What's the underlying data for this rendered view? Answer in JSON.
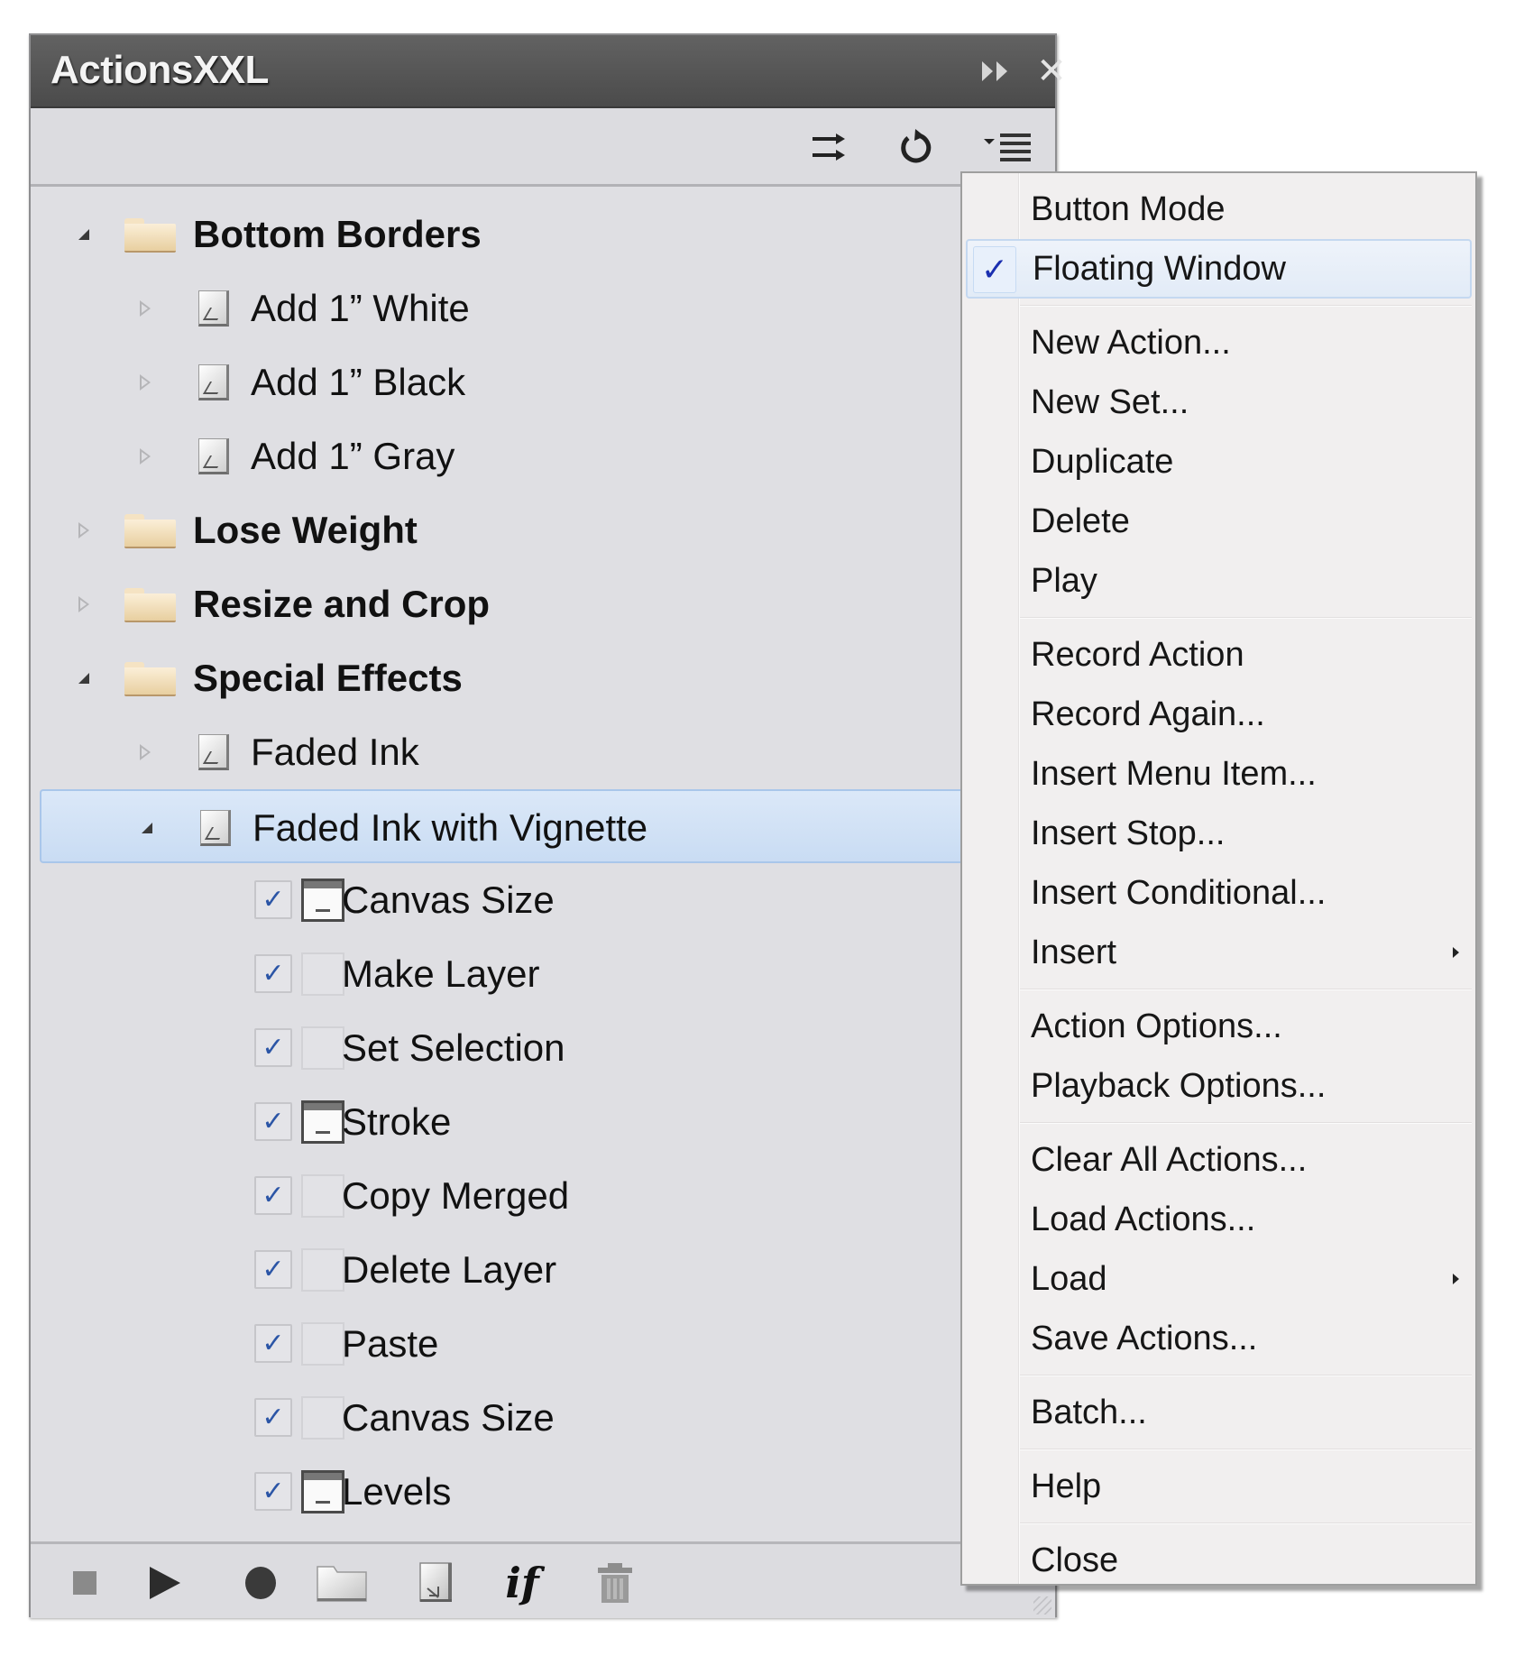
{
  "panel": {
    "title": "ActionsXXL",
    "title_buttons": [
      {
        "name": "collapse",
        "icon": "double-chevron-right-icon"
      },
      {
        "name": "close",
        "icon": "close-icon",
        "glyph": "✕"
      }
    ],
    "toolbar_icons": [
      {
        "name": "swap-icon",
        "tooltip": ""
      },
      {
        "name": "refresh-icon",
        "tooltip": ""
      },
      {
        "name": "panel-menu-icon",
        "tooltip": ""
      }
    ],
    "tree": [
      {
        "type": "set",
        "label": "Bottom Borders",
        "expanded": true,
        "level": 0
      },
      {
        "type": "action",
        "label": "Add 1” White",
        "expanded": false,
        "level": 1
      },
      {
        "type": "action",
        "label": "Add 1” Black",
        "expanded": false,
        "level": 1
      },
      {
        "type": "action",
        "label": "Add 1” Gray",
        "expanded": false,
        "level": 1
      },
      {
        "type": "set",
        "label": "Lose Weight",
        "expanded": false,
        "level": 0
      },
      {
        "type": "set",
        "label": "Resize and Crop",
        "expanded": false,
        "level": 0
      },
      {
        "type": "set",
        "label": "Special Effects",
        "expanded": true,
        "level": 0
      },
      {
        "type": "action",
        "label": "Faded Ink",
        "expanded": false,
        "level": 1
      },
      {
        "type": "action",
        "label": "Faded Ink with Vignette",
        "expanded": true,
        "level": 1,
        "selected": true
      },
      {
        "type": "step",
        "label": "Canvas Size",
        "checked": true,
        "dialog": true,
        "level": 2
      },
      {
        "type": "step",
        "label": "Make Layer",
        "checked": true,
        "dialog": false,
        "level": 2
      },
      {
        "type": "step",
        "label": "Set Selection",
        "checked": true,
        "dialog": false,
        "level": 2
      },
      {
        "type": "step",
        "label": "Stroke",
        "checked": true,
        "dialog": true,
        "level": 2
      },
      {
        "type": "step",
        "label": "Copy Merged",
        "checked": true,
        "dialog": false,
        "level": 2
      },
      {
        "type": "step",
        "label": "Delete Layer",
        "checked": true,
        "dialog": false,
        "level": 2
      },
      {
        "type": "step",
        "label": "Paste",
        "checked": true,
        "dialog": false,
        "level": 2
      },
      {
        "type": "step",
        "label": "Canvas Size",
        "checked": true,
        "dialog": false,
        "level": 2
      },
      {
        "type": "step",
        "label": "Levels",
        "checked": true,
        "dialog": true,
        "level": 2
      }
    ],
    "bottom_toolbar": [
      {
        "name": "stop-button",
        "icon": "stop-icon"
      },
      {
        "name": "play-button",
        "icon": "play-icon"
      },
      {
        "name": "record-button",
        "icon": "record-icon"
      },
      {
        "name": "new-set-button",
        "icon": "folder-icon"
      },
      {
        "name": "new-action-button",
        "icon": "new-action-icon"
      },
      {
        "name": "insert-conditional-button",
        "icon": "if-icon",
        "text": "if"
      },
      {
        "name": "delete-button",
        "icon": "trash-icon"
      }
    ]
  },
  "menu": {
    "check_glyph": "✓",
    "groups": [
      [
        {
          "label": "Button Mode"
        },
        {
          "label": "Floating Window",
          "checked": true
        }
      ],
      [
        {
          "label": "New Action..."
        },
        {
          "label": "New Set..."
        },
        {
          "label": "Duplicate"
        },
        {
          "label": "Delete"
        },
        {
          "label": "Play"
        }
      ],
      [
        {
          "label": "Record Action"
        },
        {
          "label": "Record Again..."
        },
        {
          "label": "Insert Menu Item..."
        },
        {
          "label": "Insert Stop..."
        },
        {
          "label": "Insert Conditional..."
        },
        {
          "label": "Insert",
          "submenu": true
        }
      ],
      [
        {
          "label": "Action Options..."
        },
        {
          "label": "Playback Options..."
        }
      ],
      [
        {
          "label": "Clear All Actions..."
        },
        {
          "label": "Load Actions..."
        },
        {
          "label": "Load",
          "submenu": true
        },
        {
          "label": "Save Actions..."
        }
      ],
      [
        {
          "label": "Batch..."
        }
      ],
      [
        {
          "label": "Help"
        }
      ],
      [
        {
          "label": "Close"
        }
      ]
    ]
  },
  "colors": {
    "titlebar": "#555555",
    "panel_bg": "#dfdfe3",
    "selection": "#c9dcf3",
    "menu_bg": "#f1efef",
    "check": "#2b55a6"
  }
}
